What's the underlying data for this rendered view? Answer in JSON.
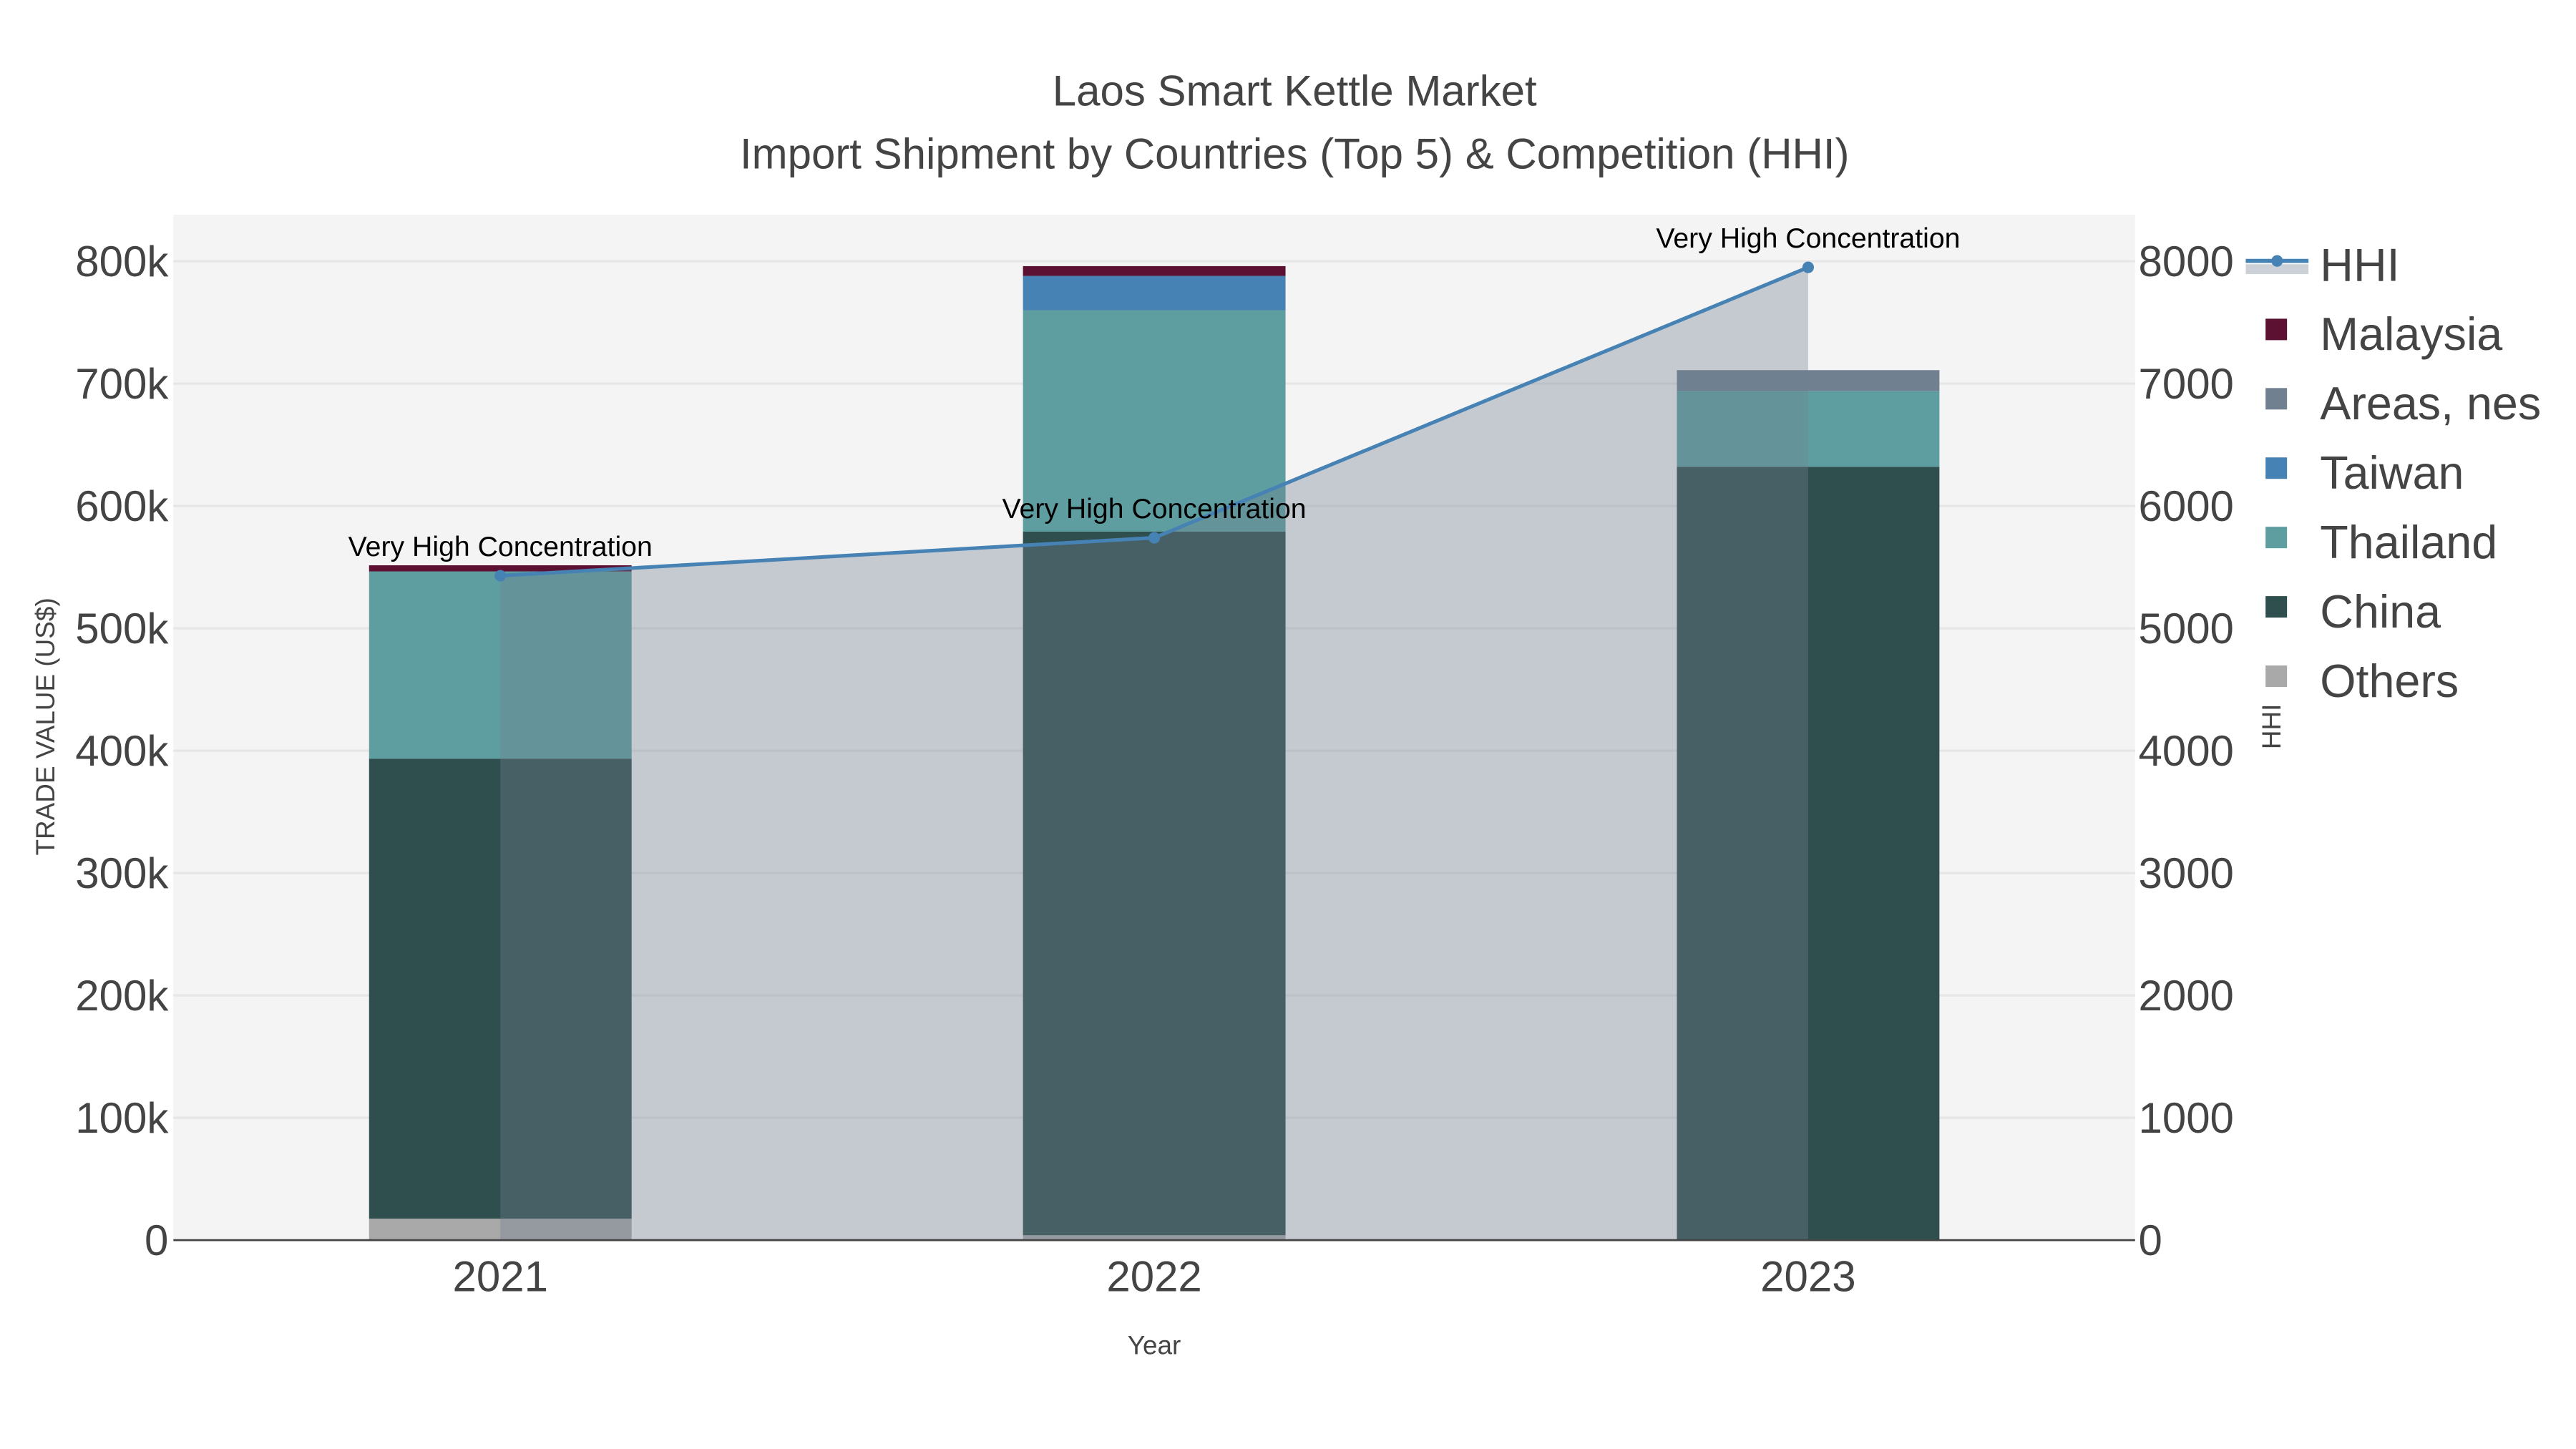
{
  "chart_data": {
    "type": "bar",
    "title": "Laos Smart Kettle Market",
    "subtitle": "Import Shipment by Countries (Top 5) & Competition (HHI)",
    "xlabel": "Year",
    "ylabel": "TRADE VALUE (US$)",
    "y2label": "HHI",
    "categories": [
      "2021",
      "2022",
      "2023"
    ],
    "barmode": "stack",
    "ylim": [
      0,
      830000
    ],
    "y2lim": [
      0,
      8300
    ],
    "yticks": [
      0,
      100000,
      200000,
      300000,
      400000,
      500000,
      600000,
      700000,
      800000
    ],
    "ytick_labels": [
      "0",
      "100k",
      "200k",
      "300k",
      "400k",
      "500k",
      "600k",
      "700k",
      "800k"
    ],
    "y2ticks": [
      0,
      1000,
      2000,
      3000,
      4000,
      5000,
      6000,
      7000,
      8000
    ],
    "y2tick_labels": [
      "0",
      "1000",
      "2000",
      "3000",
      "4000",
      "5000",
      "6000",
      "7000",
      "8000"
    ],
    "grid": true,
    "legend_placement": "right",
    "series": [
      {
        "name": "Others",
        "color": "#a9a9a9",
        "values": [
          17500,
          4000,
          0
        ]
      },
      {
        "name": "China",
        "color": "#2f4f4f",
        "values": [
          376000,
          575000,
          632000
        ]
      },
      {
        "name": "Thailand",
        "color": "#5f9ea0",
        "values": [
          153000,
          181000,
          62000
        ]
      },
      {
        "name": "Taiwan",
        "color": "#4682b4",
        "values": [
          0,
          28000,
          0
        ]
      },
      {
        "name": "Areas, nes",
        "color": "#708090",
        "values": [
          0,
          0,
          17000
        ]
      },
      {
        "name": "Malaysia",
        "color": "#5c1133",
        "values": [
          5000,
          8000,
          0
        ]
      }
    ],
    "hhi": {
      "name": "HHI",
      "color": "#4682b4",
      "fill": "#708090",
      "values": [
        5430,
        5740,
        7950
      ],
      "annotations": [
        "Very High Concentration",
        "Very High Concentration",
        "Very High Concentration"
      ]
    },
    "legend_order": [
      "HHI",
      "Malaysia",
      "Areas, nes",
      "Taiwan",
      "Thailand",
      "China",
      "Others"
    ]
  }
}
